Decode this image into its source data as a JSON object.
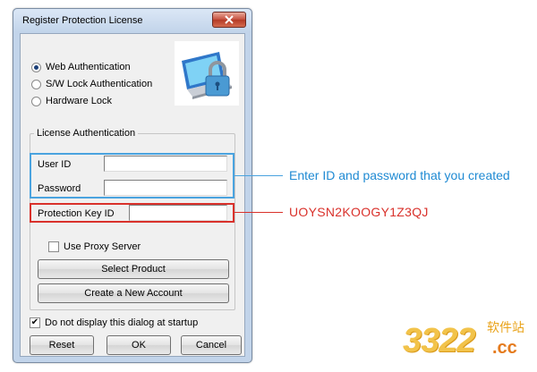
{
  "dialog": {
    "title": "Register Protection License",
    "auth_options": [
      {
        "label": "Web Authentication",
        "checked": true
      },
      {
        "label": "S/W Lock Authentication",
        "checked": false
      },
      {
        "label": "Hardware Lock",
        "checked": false
      }
    ],
    "group_title": "License Authentication",
    "user_id_label": "User ID",
    "user_id_value": "",
    "password_label": "Password",
    "password_value": "",
    "protection_key_label": "Protection Key ID",
    "protection_key_value": "",
    "proxy_label": "Use Proxy Server",
    "proxy_checked": false,
    "select_product_label": "Select Product",
    "create_account_label": "Create a New Account",
    "no_display_label": "Do not display this dialog at startup",
    "no_display_checked": true,
    "reset_label": "Reset",
    "ok_label": "OK",
    "cancel_label": "Cancel"
  },
  "annotations": {
    "blue_note": "Enter ID and password that you created",
    "red_note": "UOYSN2KOOGY1Z3QJ",
    "blue_color": "#1f8ad3",
    "red_color": "#d9312b"
  },
  "watermark": {
    "number": "3322",
    "site_cn": "软件站",
    "domain": ".cc"
  }
}
